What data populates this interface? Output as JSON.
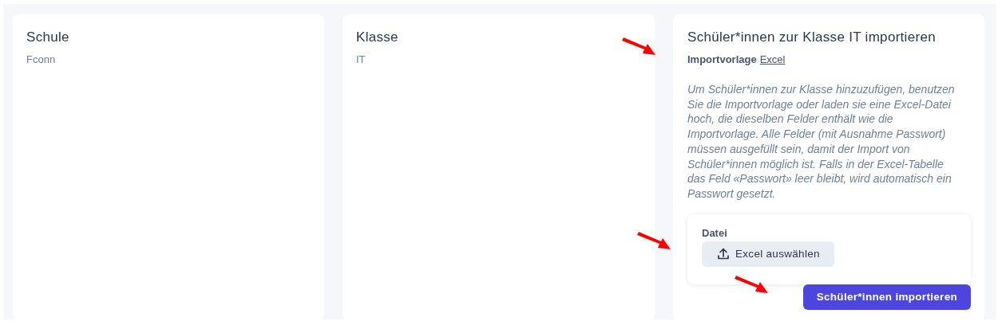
{
  "cards": [
    {
      "title": "Schule",
      "value": "Fconn"
    },
    {
      "title": "Klasse",
      "value": "IT"
    }
  ],
  "import": {
    "title": "Schüler*innen zur Klasse IT importieren",
    "template_label": "Importvorlage",
    "template_link": "Excel",
    "template_marked": true,
    "description": "Um Schüler*innen zur Klasse hinzuzufügen, benutzen Sie die Importvorlage oder laden sie eine Excel-Datei hoch, die dieselben Felder enthält wie die Importvorlage. Alle Felder (mit Ausnahme Passwort) müssen ausgefüllt sein, damit der Import von Schüler*innen möglich ist. Falls in der Excel-Tabelle das Feld «Passwort» leer bleibt, wird automatisch ein Passwort gesetzt.",
    "file_label": "Datei",
    "file_button": "Excel auswählen",
    "file_marked": true,
    "submit": "Schüler*innen importieren",
    "submit_marked": true
  }
}
